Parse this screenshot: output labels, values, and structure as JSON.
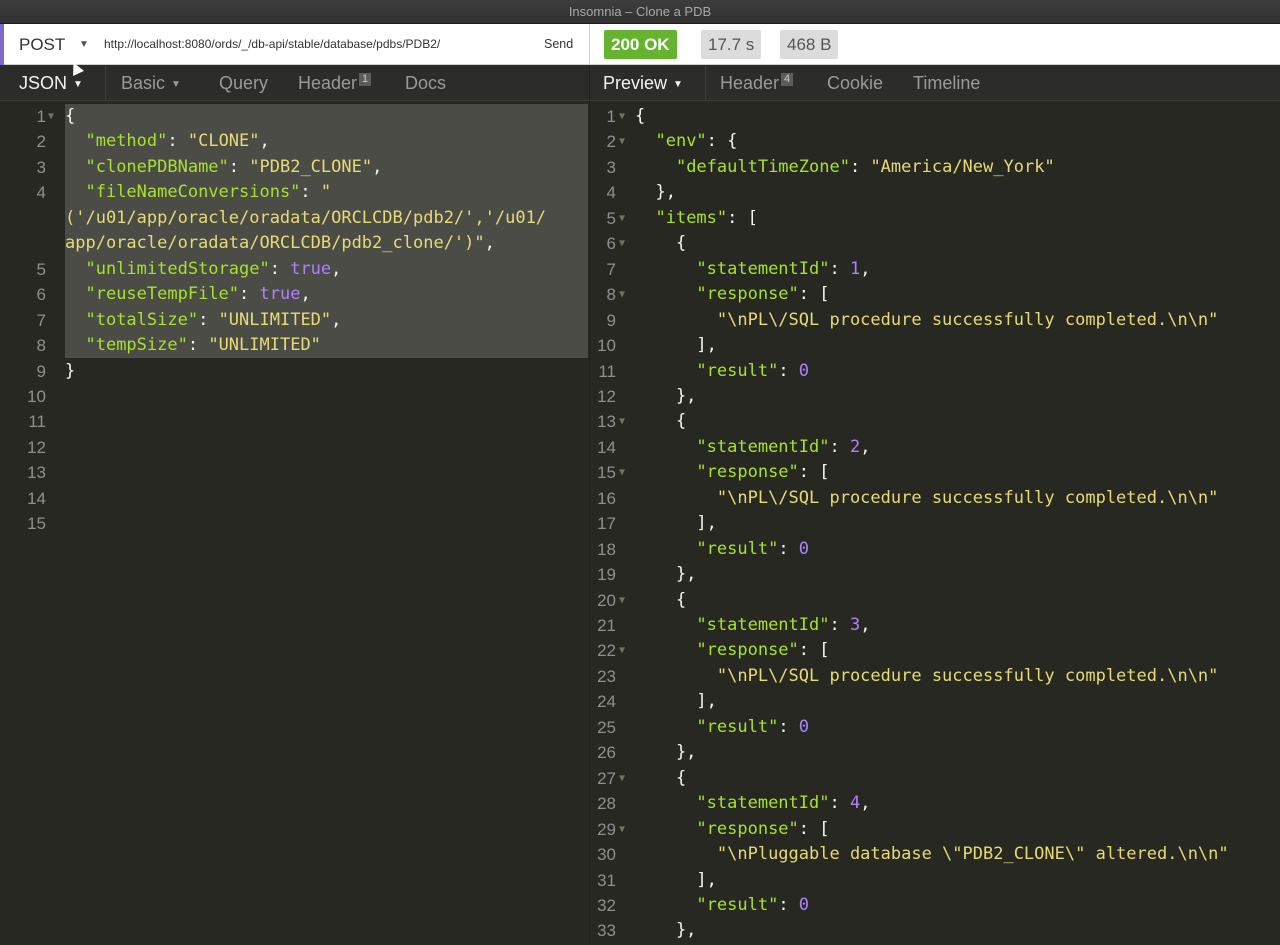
{
  "window": {
    "title": "Insomnia – Clone a PDB"
  },
  "request": {
    "method": "POST",
    "url": "http://localhost:8080/ords/_/db-api/stable/database/pdbs/PDB2/",
    "send_label": "Send"
  },
  "response_meta": {
    "status": "200 OK",
    "time": "17.7 s",
    "size": "468 B"
  },
  "request_tabs": [
    {
      "label": "JSON",
      "active": true,
      "has_caret": true
    },
    {
      "label": "Basic",
      "has_caret": true
    },
    {
      "label": "Query"
    },
    {
      "label": "Header",
      "badge": "1"
    },
    {
      "label": "Docs"
    }
  ],
  "response_tabs": [
    {
      "label": "Preview",
      "active": true,
      "has_caret": true
    },
    {
      "label": "Header",
      "badge": "4"
    },
    {
      "label": "Cookie"
    },
    {
      "label": "Timeline"
    }
  ],
  "request_body": [
    {
      "num": "1",
      "fold": true,
      "tokens": [
        [
          "p",
          "{"
        ]
      ]
    },
    {
      "num": "2",
      "tokens": [
        [
          "p",
          "  "
        ],
        [
          "k",
          "\"method\""
        ],
        [
          "p",
          ": "
        ],
        [
          "s",
          "\"CLONE\""
        ],
        [
          "p",
          ","
        ]
      ]
    },
    {
      "num": "3",
      "tokens": [
        [
          "p",
          "  "
        ],
        [
          "k",
          "\"clonePDBName\""
        ],
        [
          "p",
          ": "
        ],
        [
          "s",
          "\"PDB2_CLONE\""
        ],
        [
          "p",
          ","
        ]
      ]
    },
    {
      "num": "4",
      "tokens": [
        [
          "p",
          "  "
        ],
        [
          "k",
          "\"fileNameConversions\""
        ],
        [
          "p",
          ": "
        ],
        [
          "s",
          "\""
        ]
      ]
    },
    {
      "num": "",
      "tokens": [
        [
          "s",
          "('/u01/app/oracle/oradata/ORCLCDB/pdb2/','/u01/"
        ]
      ]
    },
    {
      "num": "",
      "tokens": [
        [
          "s",
          "app/oracle/oradata/ORCLCDB/pdb2_clone/')\""
        ],
        [
          "p",
          ","
        ]
      ]
    },
    {
      "num": "5",
      "tokens": [
        [
          "p",
          "  "
        ],
        [
          "k",
          "\"unlimitedStorage\""
        ],
        [
          "p",
          ": "
        ],
        [
          "n",
          "true"
        ],
        [
          "p",
          ","
        ]
      ]
    },
    {
      "num": "6",
      "tokens": [
        [
          "p",
          "  "
        ],
        [
          "k",
          "\"reuseTempFile\""
        ],
        [
          "p",
          ": "
        ],
        [
          "n",
          "true"
        ],
        [
          "p",
          ","
        ]
      ]
    },
    {
      "num": "7",
      "tokens": [
        [
          "p",
          "  "
        ],
        [
          "k",
          "\"totalSize\""
        ],
        [
          "p",
          ": "
        ],
        [
          "s",
          "\"UNLIMITED\""
        ],
        [
          "p",
          ","
        ]
      ]
    },
    {
      "num": "8",
      "tokens": [
        [
          "p",
          "  "
        ],
        [
          "k",
          "\"tempSize\""
        ],
        [
          "p",
          ": "
        ],
        [
          "s",
          "\"UNLIMITED\""
        ]
      ]
    },
    {
      "num": "9",
      "tokens": [
        [
          "p",
          "}"
        ]
      ]
    },
    {
      "num": "10",
      "tokens": []
    },
    {
      "num": "11",
      "tokens": []
    },
    {
      "num": "12",
      "tokens": []
    },
    {
      "num": "13",
      "tokens": []
    },
    {
      "num": "14",
      "tokens": []
    },
    {
      "num": "15",
      "tokens": []
    }
  ],
  "response_body": [
    {
      "num": "1",
      "fold": true,
      "tokens": [
        [
          "p",
          "{"
        ]
      ]
    },
    {
      "num": "2",
      "fold": true,
      "tokens": [
        [
          "p",
          "  "
        ],
        [
          "k",
          "\"env\""
        ],
        [
          "p",
          ": {"
        ]
      ]
    },
    {
      "num": "3",
      "tokens": [
        [
          "p",
          "    "
        ],
        [
          "k",
          "\"defaultTimeZone\""
        ],
        [
          "p",
          ": "
        ],
        [
          "s",
          "\"America/New_York\""
        ]
      ]
    },
    {
      "num": "4",
      "tokens": [
        [
          "p",
          "  },"
        ]
      ]
    },
    {
      "num": "5",
      "fold": true,
      "tokens": [
        [
          "p",
          "  "
        ],
        [
          "k",
          "\"items\""
        ],
        [
          "p",
          ": ["
        ]
      ]
    },
    {
      "num": "6",
      "fold": true,
      "tokens": [
        [
          "p",
          "    {"
        ]
      ]
    },
    {
      "num": "7",
      "tokens": [
        [
          "p",
          "      "
        ],
        [
          "k",
          "\"statementId\""
        ],
        [
          "p",
          ": "
        ],
        [
          "n",
          "1"
        ],
        [
          "p",
          ","
        ]
      ]
    },
    {
      "num": "8",
      "fold": true,
      "tokens": [
        [
          "p",
          "      "
        ],
        [
          "k",
          "\"response\""
        ],
        [
          "p",
          ": ["
        ]
      ]
    },
    {
      "num": "9",
      "tokens": [
        [
          "p",
          "        "
        ],
        [
          "s",
          "\"\\nPL\\/SQL procedure successfully completed.\\n\\n\""
        ]
      ]
    },
    {
      "num": "10",
      "tokens": [
        [
          "p",
          "      ],"
        ]
      ]
    },
    {
      "num": "11",
      "tokens": [
        [
          "p",
          "      "
        ],
        [
          "k",
          "\"result\""
        ],
        [
          "p",
          ": "
        ],
        [
          "n",
          "0"
        ]
      ]
    },
    {
      "num": "12",
      "tokens": [
        [
          "p",
          "    },"
        ]
      ]
    },
    {
      "num": "13",
      "fold": true,
      "tokens": [
        [
          "p",
          "    {"
        ]
      ]
    },
    {
      "num": "14",
      "tokens": [
        [
          "p",
          "      "
        ],
        [
          "k",
          "\"statementId\""
        ],
        [
          "p",
          ": "
        ],
        [
          "n",
          "2"
        ],
        [
          "p",
          ","
        ]
      ]
    },
    {
      "num": "15",
      "fold": true,
      "tokens": [
        [
          "p",
          "      "
        ],
        [
          "k",
          "\"response\""
        ],
        [
          "p",
          ": ["
        ]
      ]
    },
    {
      "num": "16",
      "tokens": [
        [
          "p",
          "        "
        ],
        [
          "s",
          "\"\\nPL\\/SQL procedure successfully completed.\\n\\n\""
        ]
      ]
    },
    {
      "num": "17",
      "tokens": [
        [
          "p",
          "      ],"
        ]
      ]
    },
    {
      "num": "18",
      "tokens": [
        [
          "p",
          "      "
        ],
        [
          "k",
          "\"result\""
        ],
        [
          "p",
          ": "
        ],
        [
          "n",
          "0"
        ]
      ]
    },
    {
      "num": "19",
      "tokens": [
        [
          "p",
          "    },"
        ]
      ]
    },
    {
      "num": "20",
      "fold": true,
      "tokens": [
        [
          "p",
          "    {"
        ]
      ]
    },
    {
      "num": "21",
      "tokens": [
        [
          "p",
          "      "
        ],
        [
          "k",
          "\"statementId\""
        ],
        [
          "p",
          ": "
        ],
        [
          "n",
          "3"
        ],
        [
          "p",
          ","
        ]
      ]
    },
    {
      "num": "22",
      "fold": true,
      "tokens": [
        [
          "p",
          "      "
        ],
        [
          "k",
          "\"response\""
        ],
        [
          "p",
          ": ["
        ]
      ]
    },
    {
      "num": "23",
      "tokens": [
        [
          "p",
          "        "
        ],
        [
          "s",
          "\"\\nPL\\/SQL procedure successfully completed.\\n\\n\""
        ]
      ]
    },
    {
      "num": "24",
      "tokens": [
        [
          "p",
          "      ],"
        ]
      ]
    },
    {
      "num": "25",
      "tokens": [
        [
          "p",
          "      "
        ],
        [
          "k",
          "\"result\""
        ],
        [
          "p",
          ": "
        ],
        [
          "n",
          "0"
        ]
      ]
    },
    {
      "num": "26",
      "tokens": [
        [
          "p",
          "    },"
        ]
      ]
    },
    {
      "num": "27",
      "fold": true,
      "tokens": [
        [
          "p",
          "    {"
        ]
      ]
    },
    {
      "num": "28",
      "tokens": [
        [
          "p",
          "      "
        ],
        [
          "k",
          "\"statementId\""
        ],
        [
          "p",
          ": "
        ],
        [
          "n",
          "4"
        ],
        [
          "p",
          ","
        ]
      ]
    },
    {
      "num": "29",
      "fold": true,
      "tokens": [
        [
          "p",
          "      "
        ],
        [
          "k",
          "\"response\""
        ],
        [
          "p",
          ": ["
        ]
      ]
    },
    {
      "num": "30",
      "tokens": [
        [
          "p",
          "        "
        ],
        [
          "s",
          "\"\\nPluggable database \\\"PDB2_CLONE\\\" altered.\\n\\n\""
        ]
      ]
    },
    {
      "num": "31",
      "tokens": [
        [
          "p",
          "      ],"
        ]
      ]
    },
    {
      "num": "32",
      "tokens": [
        [
          "p",
          "      "
        ],
        [
          "k",
          "\"result\""
        ],
        [
          "p",
          ": "
        ],
        [
          "n",
          "0"
        ]
      ]
    },
    {
      "num": "33",
      "tokens": [
        [
          "p",
          "    },"
        ]
      ]
    }
  ]
}
